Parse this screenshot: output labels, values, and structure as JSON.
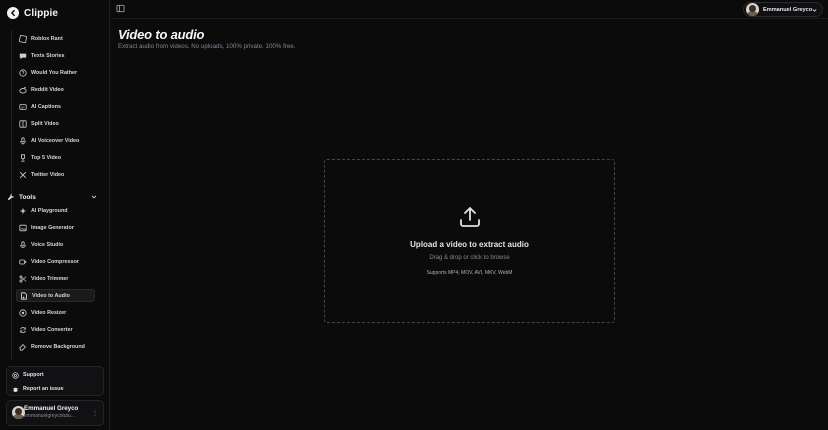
{
  "brand": {
    "name": "Clippie"
  },
  "sidebar": {
    "items": [
      {
        "label": "Roblox Rant",
        "icon": "gamepad-icon"
      },
      {
        "label": "Texts Stories",
        "icon": "message-icon"
      },
      {
        "label": "Would You Rather",
        "icon": "question-icon"
      },
      {
        "label": "Reddit Video",
        "icon": "reddit-icon"
      },
      {
        "label": "AI Captions",
        "icon": "captions-icon"
      },
      {
        "label": "Split Video",
        "icon": "split-icon"
      },
      {
        "label": "AI Voiceover Video",
        "icon": "microphone-icon"
      },
      {
        "label": "Top 5 Video",
        "icon": "trophy-icon"
      },
      {
        "label": "Twitter Video",
        "icon": "x-icon"
      }
    ],
    "tools_section": {
      "label": "Tools"
    },
    "tools": [
      {
        "label": "AI Playground",
        "icon": "sparkle-icon"
      },
      {
        "label": "Image Generator",
        "icon": "image-icon"
      },
      {
        "label": "Voice Studio",
        "icon": "mic-icon"
      },
      {
        "label": "Video Compressor",
        "icon": "video-icon"
      },
      {
        "label": "Video Trimmer",
        "icon": "scissors-icon"
      },
      {
        "label": "Video to Audio",
        "icon": "audio-file-icon",
        "active": true
      },
      {
        "label": "Video Resizer",
        "icon": "resize-icon"
      },
      {
        "label": "Video Converter",
        "icon": "refresh-icon"
      },
      {
        "label": "Remove Background",
        "icon": "eraser-icon"
      }
    ],
    "support": [
      {
        "label": "Support",
        "icon": "help-circle-icon"
      },
      {
        "label": "Report an issue",
        "icon": "bug-icon"
      }
    ],
    "user": {
      "name": "Emmanuel Greyco",
      "email": "emmanuelgreycotutu..."
    }
  },
  "header": {
    "account_name": "Emmanuel Greyco"
  },
  "main": {
    "title": "Video to audio",
    "subtitle": "Extract audio from videos. No uploads, 100% private. 100% free.",
    "dropzone": {
      "title": "Upload a video to extract audio",
      "subtitle": "Drag & drop or click to browse",
      "formats": "Supports MP4, MOV, AVI, MKV, WebM"
    }
  },
  "colors": {
    "background": "#0b0b0c",
    "border": "#45454a",
    "subtitle": "#7f8794"
  }
}
